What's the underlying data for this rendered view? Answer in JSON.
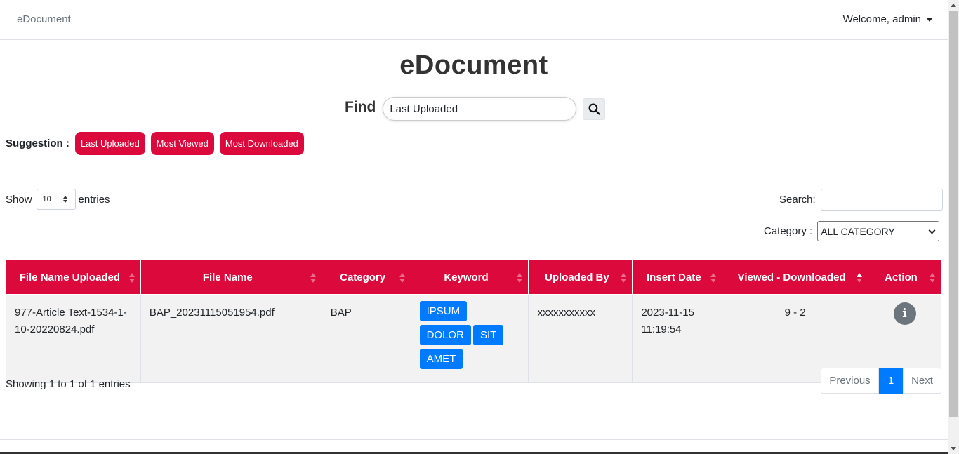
{
  "navbar": {
    "brand": "eDocument",
    "welcome": "Welcome, admin"
  },
  "page": {
    "title": "eDocument"
  },
  "find": {
    "label": "Find",
    "value": "Last Uploaded"
  },
  "suggestion": {
    "label": "Suggestion :",
    "items": [
      "Last Uploaded",
      "Most Viewed",
      "Most Downloaded"
    ]
  },
  "length": {
    "show": "Show",
    "value": "10",
    "entries": "entries"
  },
  "search": {
    "label": "Search:"
  },
  "category": {
    "label": "Category :",
    "selected": "ALL CATEGORY"
  },
  "table": {
    "headers": [
      "File Name Uploaded",
      "File Name",
      "Category",
      "Keyword",
      "Uploaded By",
      "Insert Date",
      "Viewed - Downloaded",
      "Action"
    ],
    "rows": [
      {
        "file_uploaded": "977-Article Text-1534-1-10-20220824.pdf",
        "file_name": "BAP_20231115051954.pdf",
        "category": "BAP",
        "keywords": [
          "IPSUM",
          "DOLOR",
          "SIT",
          "AMET"
        ],
        "uploaded_by": "xxxxxxxxxxx",
        "insert_date": "2023-11-15 11:19:54",
        "viewed_downloaded": "9 - 2",
        "action_icon": "info-icon"
      }
    ]
  },
  "info": {
    "showing": "Showing 1 to 1 of 1 entries"
  },
  "pagination": {
    "previous": "Previous",
    "current": "1",
    "next": "Next"
  },
  "colors": {
    "accent": "#dc0a3c",
    "keyword": "#007bff",
    "action": "#6c757d"
  }
}
